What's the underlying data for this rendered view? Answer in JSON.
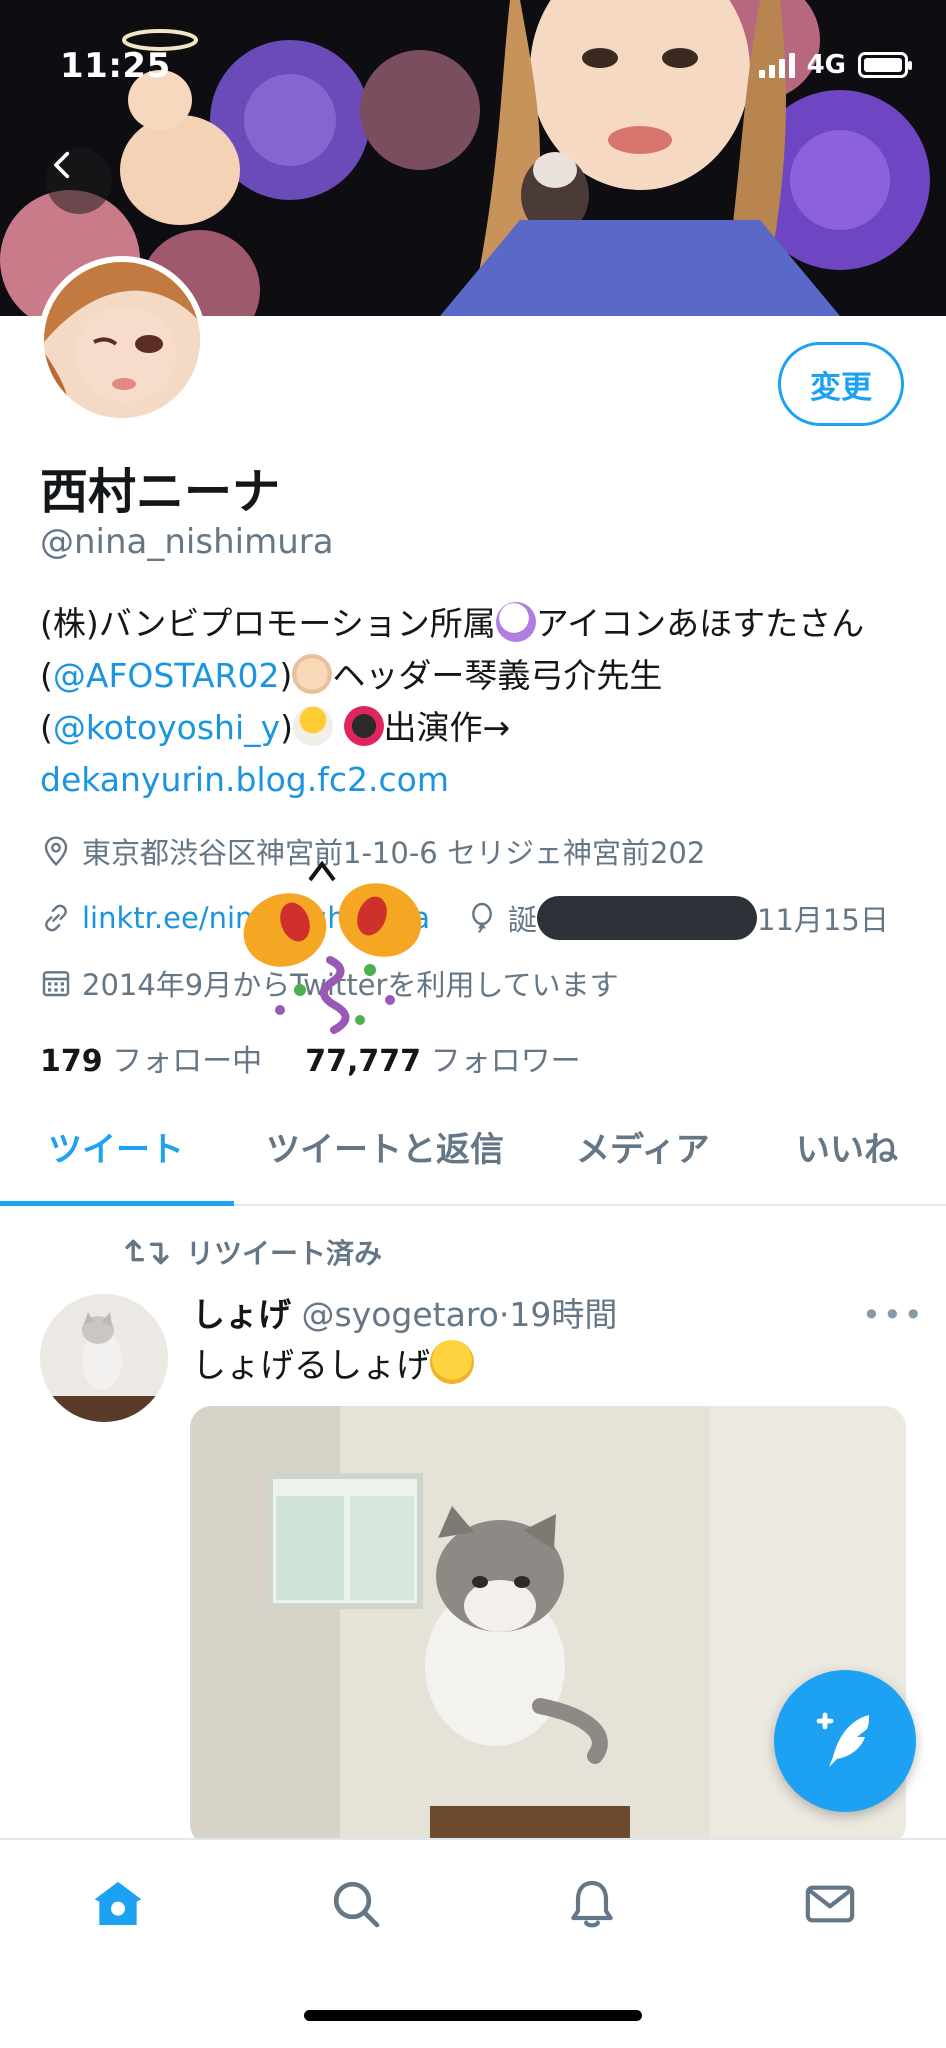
{
  "status_bar": {
    "time": "11:25",
    "network": "4G"
  },
  "profile": {
    "name": "西村ニーナ",
    "handle": "@nina_nishimura",
    "edit_label": "変更",
    "bio": {
      "part1": "(株)バンビプロモーション所属",
      "part2": "アイコンあほすたさん(",
      "mention1": "@AFOSTAR02",
      "part3": ")",
      "part4": "ヘッダー琴義弓介先生(",
      "mention2": "@kotoyoshi_y",
      "part5": ")",
      "part6": "出演作→",
      "link": "dekanyurin.blog.fc2.com"
    },
    "location": "東京都渋谷区神宮前1-10-6 セリジェ神宮前202",
    "website": "linktr.ee/nina_nishimura",
    "birthday_prefix": "誕",
    "birthday_suffix": "11月15日",
    "joined": "2014年9月からTwitterを利用しています",
    "following_count": "179",
    "following_label": "フォロー中",
    "followers_count": "77,777",
    "followers_label": "フォロワー"
  },
  "tabs": [
    {
      "label": "ツイート",
      "active": true
    },
    {
      "label": "ツイートと返信",
      "active": false
    },
    {
      "label": "メディア",
      "active": false
    },
    {
      "label": "いいね",
      "active": false
    }
  ],
  "tweet": {
    "retweet_label": "リツイート済み",
    "author_name": "しょげ",
    "author_handle": "@syogetaro",
    "time": "19時間",
    "text": "しょげるしょげ",
    "more": "•••"
  },
  "colors": {
    "accent": "#1da1f2",
    "link": "#1b95e0",
    "secondary": "#657786"
  },
  "icons": {
    "back": "chevron-left-icon",
    "location": "location-pin-icon",
    "website": "link-icon",
    "birthday": "balloon-icon",
    "joined": "calendar-icon",
    "retweet": "retweet-icon",
    "compose": "compose-tweet-icon",
    "nav": [
      "home-icon",
      "search-icon",
      "notifications-bell-icon",
      "messages-envelope-icon"
    ]
  }
}
